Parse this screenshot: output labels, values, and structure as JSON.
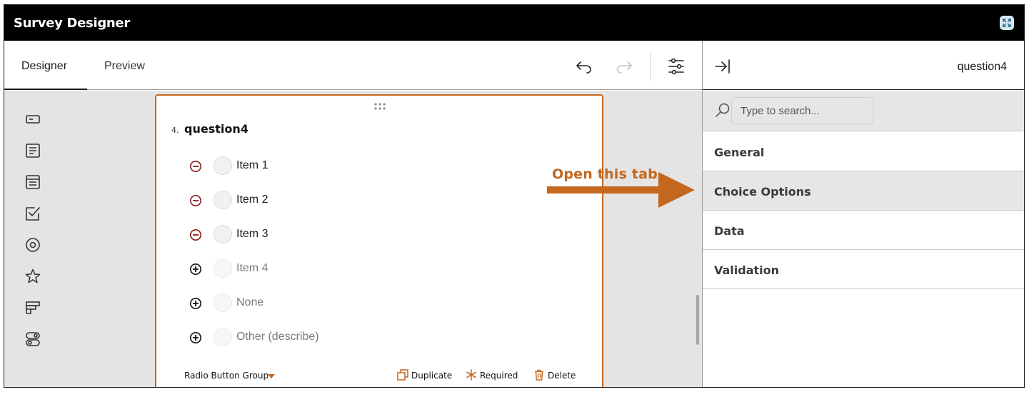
{
  "window": {
    "title": "Survey Designer"
  },
  "tabs": [
    {
      "label": "Designer",
      "active": true
    },
    {
      "label": "Preview",
      "active": false
    }
  ],
  "toolbar": {
    "icons": [
      "undo-icon",
      "redo-icon",
      "settings-sliders-icon"
    ]
  },
  "toolbox": {
    "icons": [
      "text-input-icon",
      "comment-icon",
      "dropdown-icon",
      "checkbox-icon",
      "radiogroup-icon",
      "rating-icon",
      "ranking-icon",
      "boolean-icon"
    ]
  },
  "question": {
    "number": "4.",
    "title": "question4",
    "choices": [
      {
        "label": "Item 1",
        "control": "remove",
        "active": true
      },
      {
        "label": "Item 2",
        "control": "remove",
        "active": true
      },
      {
        "label": "Item 3",
        "control": "remove",
        "active": true
      },
      {
        "label": "Item 4",
        "control": "add",
        "active": false
      },
      {
        "label": "None",
        "control": "add",
        "active": false
      },
      {
        "label": "Other (describe)",
        "control": "add",
        "active": false
      }
    ],
    "type_label": "Radio Button Group",
    "actions": {
      "duplicate": "Duplicate",
      "required": "Required",
      "delete": "Delete"
    }
  },
  "annotation": {
    "text": "Open this tab"
  },
  "panel": {
    "question_name": "question4",
    "search_placeholder": "Type to search...",
    "sections": [
      {
        "label": "General",
        "active": false
      },
      {
        "label": "Choice Options",
        "active": true
      },
      {
        "label": "Data",
        "active": false
      },
      {
        "label": "Validation",
        "active": false
      }
    ]
  },
  "colors": {
    "accent": "#c4671f",
    "remove": "#8b1a1a",
    "titlebar": "#000000",
    "canvas": "#e4e4e4"
  }
}
